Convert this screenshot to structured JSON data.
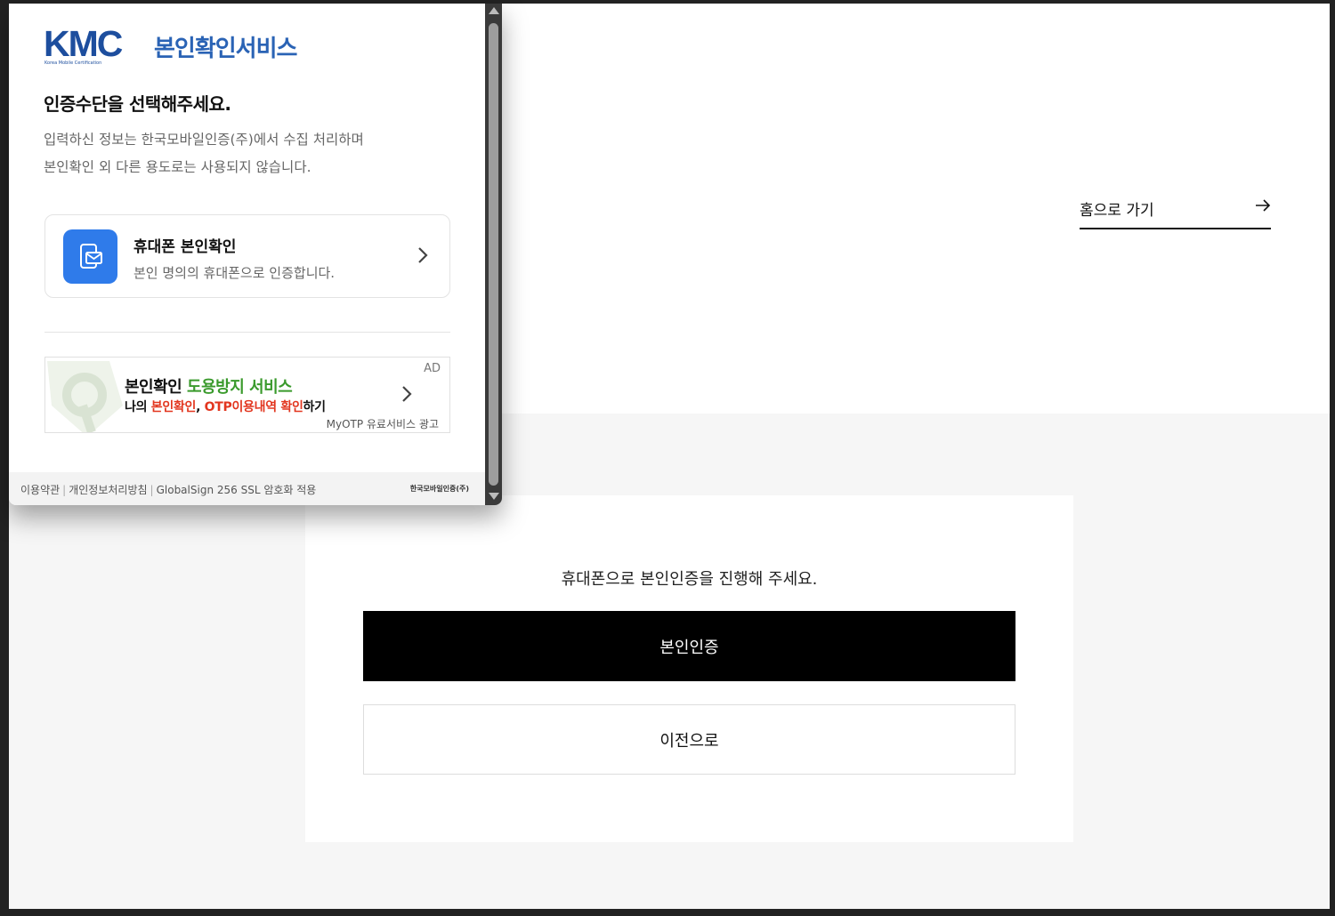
{
  "page": {
    "home_link_label": "홈으로 가기",
    "prompt": "휴대폰으로 본인인증을 진행해 주세요.",
    "verify_button": "본인인증",
    "back_button": "이전으로"
  },
  "popup": {
    "logo_text": "KMC",
    "logo_subtext": "Korea Mobile Certification",
    "service_title": "본인확인서비스",
    "headline": "인증수단을 선택해주세요.",
    "notice_line1": "입력하신 정보는 한국모바일인증(주)에서 수집 처리하며",
    "notice_line2": "본인확인 외 다른 용도로는 사용되지 않습니다.",
    "method": {
      "title": "휴대폰 본인확인",
      "description": "본인 명의의 휴대폰으로 인증합니다.",
      "icon": "phone-id-icon"
    },
    "ad": {
      "tag": "AD",
      "line1_prefix": "본인확인 ",
      "line1_highlight": "도용방지 서비스",
      "line2_prefix": "나의 ",
      "line2_red1": "본인확인",
      "line2_comma": ", ",
      "line2_red2": "OTP이용내역 확인",
      "line2_suffix": "하기",
      "sub": "MyOTP 유료서비스 광고"
    },
    "footer": {
      "terms": "이용약관",
      "privacy": "개인정보처리방침",
      "ssl": "GlobalSign 256 SSL 암호화 적용",
      "brand": "한국모바일인증(주)"
    }
  },
  "colors": {
    "kmc_blue": "#1d4e9e",
    "method_icon_blue": "#2f7bea",
    "ad_green": "#3a9a2c",
    "ad_red": "#e2361f",
    "primary_button": "#000000"
  }
}
